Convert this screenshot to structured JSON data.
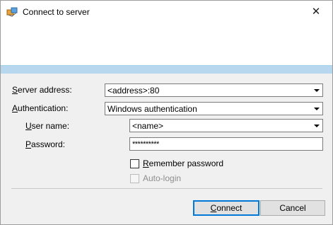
{
  "window": {
    "title": "Connect to server",
    "close_glyph": "✕",
    "app_icon": "server-connect-icon"
  },
  "form": {
    "server_address": {
      "label_ul": "S",
      "label_rest": "erver address:",
      "value": "<address>:80"
    },
    "authentication": {
      "label_ul": "A",
      "label_rest": "uthentication:",
      "value": "Windows authentication"
    },
    "user_name": {
      "label_ul": "U",
      "label_rest": "ser name:",
      "value": "<name>"
    },
    "password": {
      "label_ul": "P",
      "label_rest": "assword:",
      "value": "**********"
    },
    "remember_password": {
      "label_ul": "R",
      "label_rest": "emember password",
      "checked": false
    },
    "auto_login": {
      "label": "Auto-login",
      "checked": false,
      "disabled": true
    }
  },
  "buttons": {
    "connect": {
      "label_ul": "C",
      "label_rest": "onnect"
    },
    "cancel": {
      "label": "Cancel"
    }
  },
  "colors": {
    "stripe": "#b7d7ef",
    "dialog_bg": "#f0f0f0",
    "default_button_border": "#0078d7"
  }
}
